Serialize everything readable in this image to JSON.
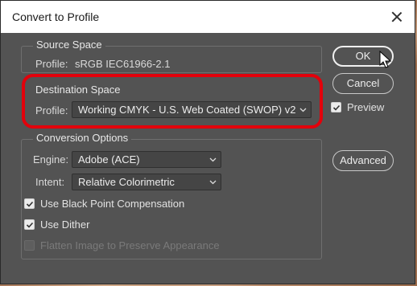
{
  "window": {
    "title": "Convert to Profile"
  },
  "source_space": {
    "legend": "Source Space",
    "profile_label": "Profile:",
    "profile_value": "sRGB IEC61966-2.1"
  },
  "destination_space": {
    "legend": "Destination Space",
    "profile_label": "Profile:",
    "profile_selected": "Working CMYK - U.S. Web Coated (SWOP) v2"
  },
  "conversion_options": {
    "legend": "Conversion Options",
    "engine_label": "Engine:",
    "engine_selected": "Adobe (ACE)",
    "intent_label": "Intent:",
    "intent_selected": "Relative Colorimetric",
    "black_point_label": "Use Black Point Compensation",
    "black_point_checked": true,
    "dither_label": "Use Dither",
    "dither_checked": true,
    "flatten_label": "Flatten Image to Preserve Appearance",
    "flatten_checked": false,
    "flatten_enabled": false
  },
  "buttons": {
    "ok": "OK",
    "cancel": "Cancel",
    "advanced": "Advanced"
  },
  "preview": {
    "label": "Preview",
    "checked": true
  },
  "colors": {
    "dialog_bg": "#535353",
    "highlight": "#e3000b",
    "titlebar_bg": "#ffffff"
  }
}
